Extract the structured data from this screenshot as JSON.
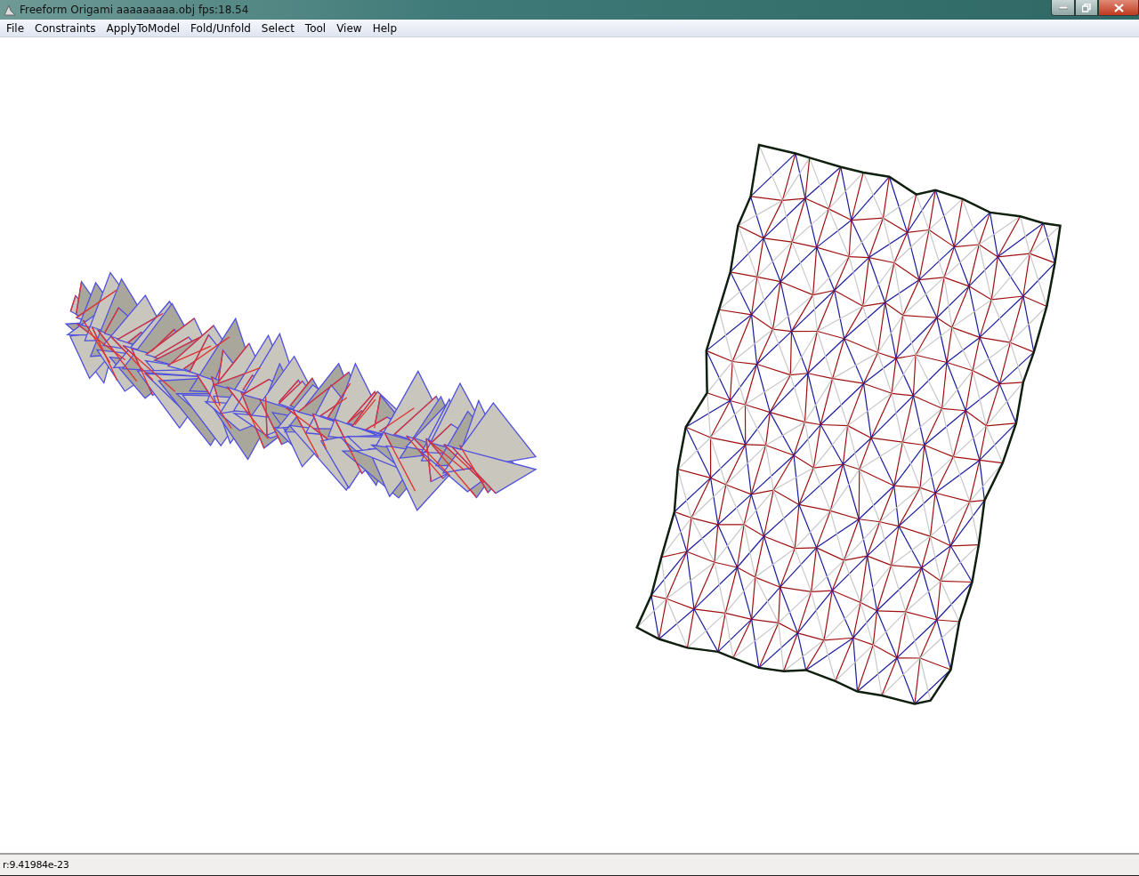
{
  "window": {
    "title": "Freeform Origami aaaaaaaaa.obj fps:18.54"
  },
  "menu": [
    "File",
    "Constraints",
    "ApplyToModel",
    "Fold/Unfold",
    "Select",
    "Tool",
    "View",
    "Help"
  ],
  "status_bar": {
    "text": "r:9.41984e-23"
  }
}
